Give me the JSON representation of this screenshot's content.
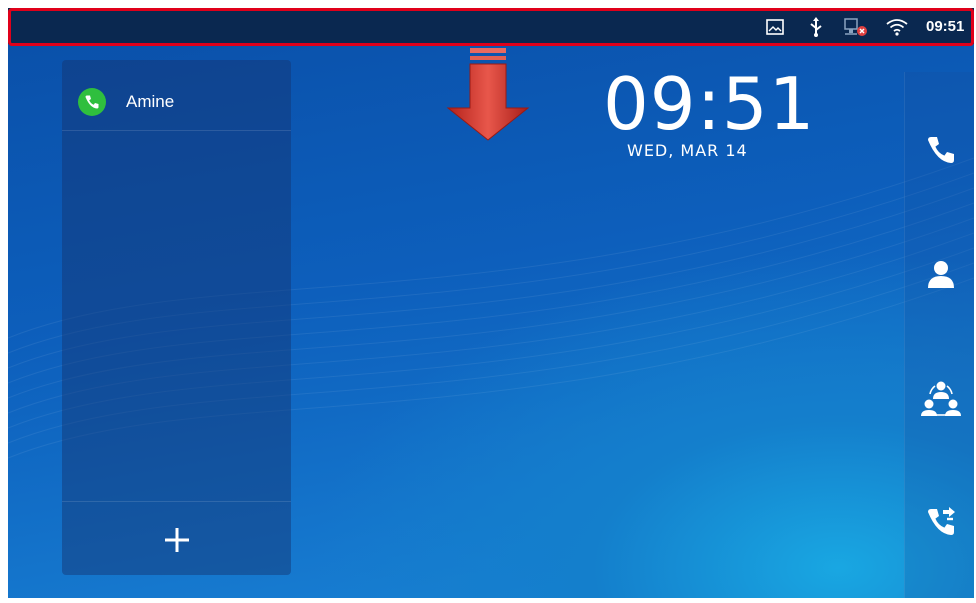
{
  "statusbar": {
    "icons": [
      "screenshot-icon",
      "usb-icon",
      "network-error-icon",
      "wifi-icon"
    ],
    "time": "09:51",
    "highlight_color": "#e0001a"
  },
  "left_panel": {
    "contacts": [
      {
        "name": "Amine",
        "status_color": "#2fbf3e"
      }
    ],
    "add_label": "+"
  },
  "clock": {
    "time": "09:51",
    "date": "WED, MAR 14"
  },
  "right_sidebar": {
    "items": [
      "phone-icon",
      "contacts-icon",
      "conference-icon",
      "call-forward-icon"
    ]
  },
  "annotation": {
    "arrow_color": "#d9342b"
  }
}
